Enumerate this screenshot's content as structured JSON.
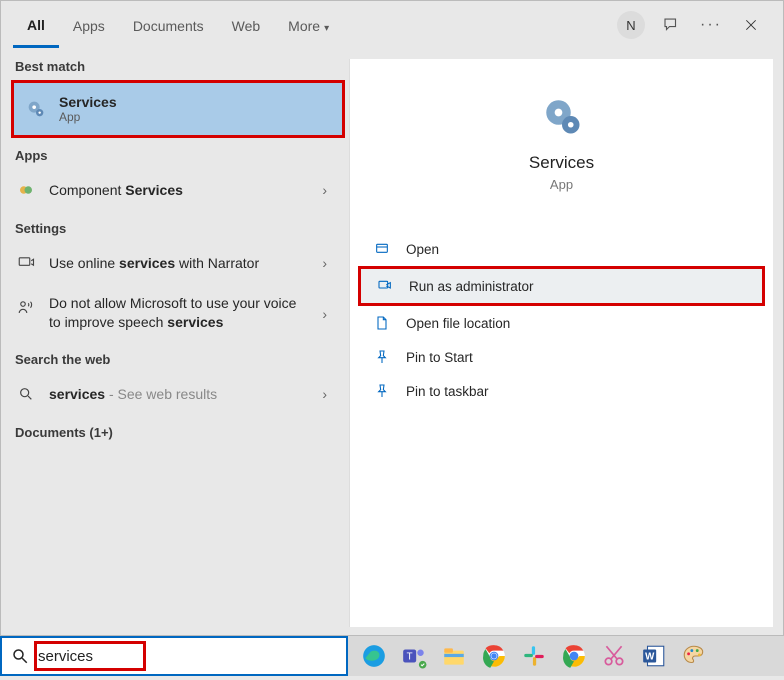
{
  "tabs": {
    "all": "All",
    "apps": "Apps",
    "documents": "Documents",
    "web": "Web",
    "more": "More"
  },
  "titlebar": {
    "avatar_initial": "N"
  },
  "sections": {
    "best": "Best match",
    "apps": "Apps",
    "settings": "Settings",
    "web": "Search the web",
    "documents": "Documents (1+)"
  },
  "best_match": {
    "title": "Services",
    "subtitle": "App"
  },
  "apps_results": {
    "item0_pre": "Component ",
    "item0_bold": "Services"
  },
  "settings_results": {
    "item0_pre": "Use online ",
    "item0_bold": "services",
    "item0_post": " with Narrator",
    "item1_pre": "Do not allow Microsoft to use your voice to improve speech ",
    "item1_bold": "services"
  },
  "web_results": {
    "item0_bold": "services",
    "item0_post": " - See web results"
  },
  "preview": {
    "title": "Services",
    "subtitle": "App"
  },
  "actions": {
    "open": "Open",
    "run_admin": "Run as administrator",
    "open_loc": "Open file location",
    "pin_start": "Pin to Start",
    "pin_taskbar": "Pin to taskbar"
  },
  "search": {
    "value": "services"
  }
}
